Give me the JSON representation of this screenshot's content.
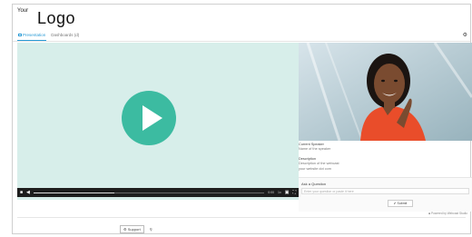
{
  "header": {
    "logo_small": "Your",
    "logo_big": "Logo",
    "tabs": [
      {
        "label": "Presentation"
      },
      {
        "label": "Dashboards (d)"
      }
    ],
    "settings_icon": "gear-icon"
  },
  "player": {
    "play_icon": "play-icon",
    "current_time": "0:00",
    "progress": 0.35,
    "speed": "1x"
  },
  "sidebar": {
    "current_speaker_label": "Current Speaker",
    "current_speaker_value": "Name of the speaker",
    "description_label": "Description",
    "description_lines": [
      "Description of the webcast",
      "your website dot com"
    ]
  },
  "qa": {
    "title": "Ask a Question",
    "placeholder": "Enter your question or paste it here",
    "submit_label": "Submit"
  },
  "footer": {
    "powered": "Powered by Webcast Studio",
    "support_label": "Support"
  },
  "colors": {
    "accent": "#2a9bd6",
    "play": "#3cbba1",
    "video_bg": "#d7eeea"
  }
}
